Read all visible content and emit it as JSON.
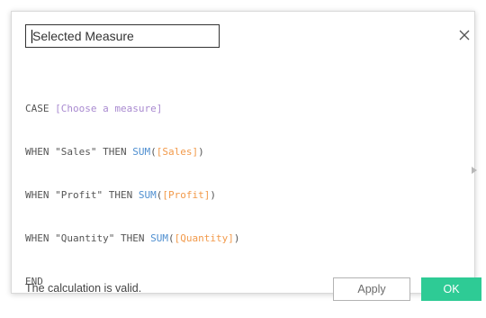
{
  "dialog": {
    "name_value": "Selected Measure",
    "close_icon": "close-icon"
  },
  "formula": {
    "line1": {
      "kw": "CASE ",
      "param": "[Choose a measure]"
    },
    "line2": {
      "kw1": "WHEN ",
      "str": "\"Sales\"",
      "kw2": " THEN ",
      "fn": "SUM",
      "open": "(",
      "field": "[Sales]",
      "close": ")"
    },
    "line3": {
      "kw1": "WHEN ",
      "str": "\"Profit\"",
      "kw2": " THEN ",
      "fn": "SUM",
      "open": "(",
      "field": "[Profit]",
      "close": ")"
    },
    "line4": {
      "kw1": "WHEN ",
      "str": "\"Quantity\"",
      "kw2": " THEN ",
      "fn": "SUM",
      "open": "(",
      "field": "[Quantity]",
      "close": ")"
    },
    "line5": {
      "kw": "END"
    }
  },
  "footer": {
    "status_text": "The calculation is valid.",
    "apply_label": "Apply",
    "ok_label": "OK"
  },
  "colors": {
    "ok_button": "#2ecb95",
    "function": "#4f8fd0",
    "field": "#f29a4b",
    "parameter": "#a98ad0"
  },
  "icons": {
    "close": "close-icon",
    "expand": "triangle-right-icon"
  }
}
